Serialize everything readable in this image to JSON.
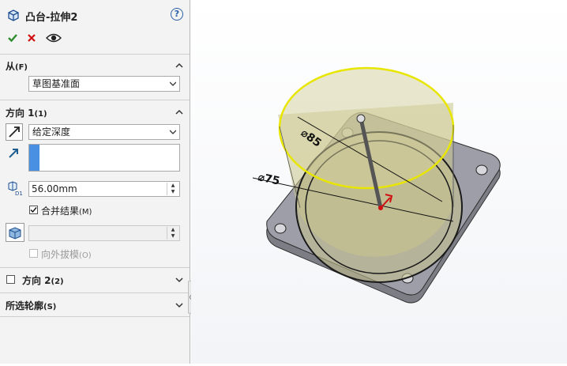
{
  "feature": {
    "title": "凸台-拉伸2"
  },
  "from_section": {
    "title": "从",
    "shortcut": "(F)",
    "start_condition": "草图基准面"
  },
  "direction1": {
    "title": "方向 1",
    "shortcut": "(1)",
    "end_condition": "给定深度",
    "depth_value": "56.00mm",
    "merge_label": "合并结果",
    "merge_shortcut": "(M)",
    "merge_checked": true,
    "draft_outward_label": "向外拔模",
    "draft_outward_shortcut": "(O)"
  },
  "direction2": {
    "title": "方向 2",
    "shortcut": "(2)"
  },
  "selected_contours": {
    "title": "所选轮廓",
    "shortcut": "(S)"
  },
  "viewport": {
    "dim_outer": "85",
    "dim_inner": "75"
  },
  "colors": {
    "accent_check": "#2e8b2e",
    "accent_cancel": "#d01010",
    "direction_field": "#4a90e2",
    "extrude_preview": "#c8c48a",
    "highlight_edge": "#e8e600"
  }
}
